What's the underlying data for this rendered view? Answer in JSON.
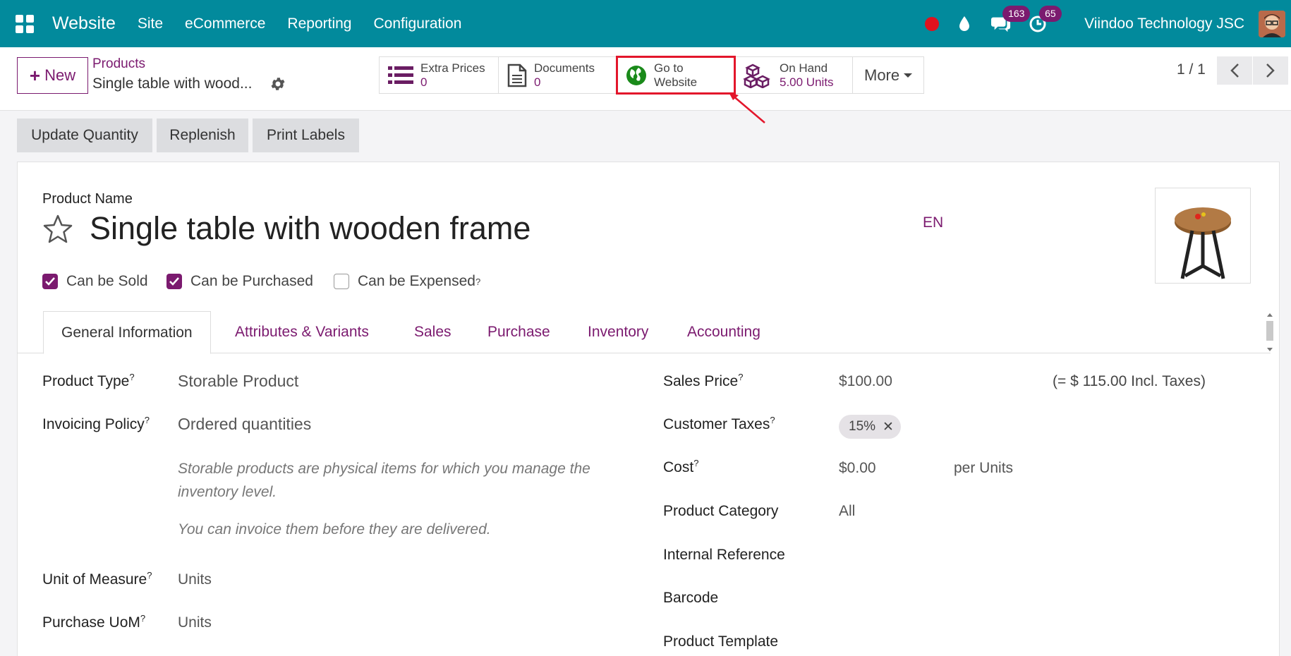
{
  "nav": {
    "app_title": "Website",
    "menu": [
      "Site",
      "eCommerce",
      "Reporting",
      "Configuration"
    ],
    "messages_count": "163",
    "activities_count": "65",
    "company": "Viindoo Technology JSC"
  },
  "control": {
    "new_label": "New",
    "breadcrumb_parent": "Products",
    "breadcrumb_current": "Single table with wood...",
    "smart_buttons": [
      {
        "label": "Extra Prices",
        "value": "0",
        "icon": "list-icon"
      },
      {
        "label": "Documents",
        "value": "0",
        "icon": "document-icon"
      },
      {
        "label": "Go to",
        "value": "Website",
        "icon": "globe-icon"
      },
      {
        "label": "On Hand",
        "value": "5.00 Units",
        "icon": "cubes-icon"
      }
    ],
    "more_label": "More",
    "pager": "1 / 1"
  },
  "actions": [
    "Update Quantity",
    "Replenish",
    "Print Labels"
  ],
  "form": {
    "name_label": "Product Name",
    "product_name": "Single table with wooden frame",
    "lang": "EN",
    "checks": [
      {
        "label": "Can be Sold",
        "checked": true
      },
      {
        "label": "Can be Purchased",
        "checked": true
      },
      {
        "label": "Can be Expensed",
        "checked": false,
        "help": "?"
      }
    ],
    "tabs": [
      "General Information",
      "Attributes & Variants",
      "Sales",
      "Purchase",
      "Inventory",
      "Accounting"
    ],
    "left": {
      "product_type_label": "Product Type",
      "product_type_value": "Storable Product",
      "invoicing_label": "Invoicing Policy",
      "invoicing_value": "Ordered quantities",
      "help1": "Storable products are physical items for which you manage the inventory level.",
      "help2": "You can invoice them before they are delivered.",
      "uom_label": "Unit of Measure",
      "uom_value": "Units",
      "purchase_uom_label": "Purchase UoM",
      "purchase_uom_value": "Units"
    },
    "right": {
      "sales_price_label": "Sales Price",
      "sales_price_value": "$100.00",
      "incl_taxes": "(= $ 115.00 Incl. Taxes)",
      "customer_taxes_label": "Customer Taxes",
      "tax_tag": "15%",
      "cost_label": "Cost",
      "cost_value": "$0.00",
      "cost_unit": "per Units",
      "category_label": "Product Category",
      "category_value": "All",
      "internal_ref_label": "Internal Reference",
      "barcode_label": "Barcode",
      "template_label": "Product Template"
    },
    "help_mark": "?"
  },
  "colors": {
    "nav_bg": "#028a9c",
    "accent": "#7b1a6f",
    "highlight": "#e3162b"
  }
}
